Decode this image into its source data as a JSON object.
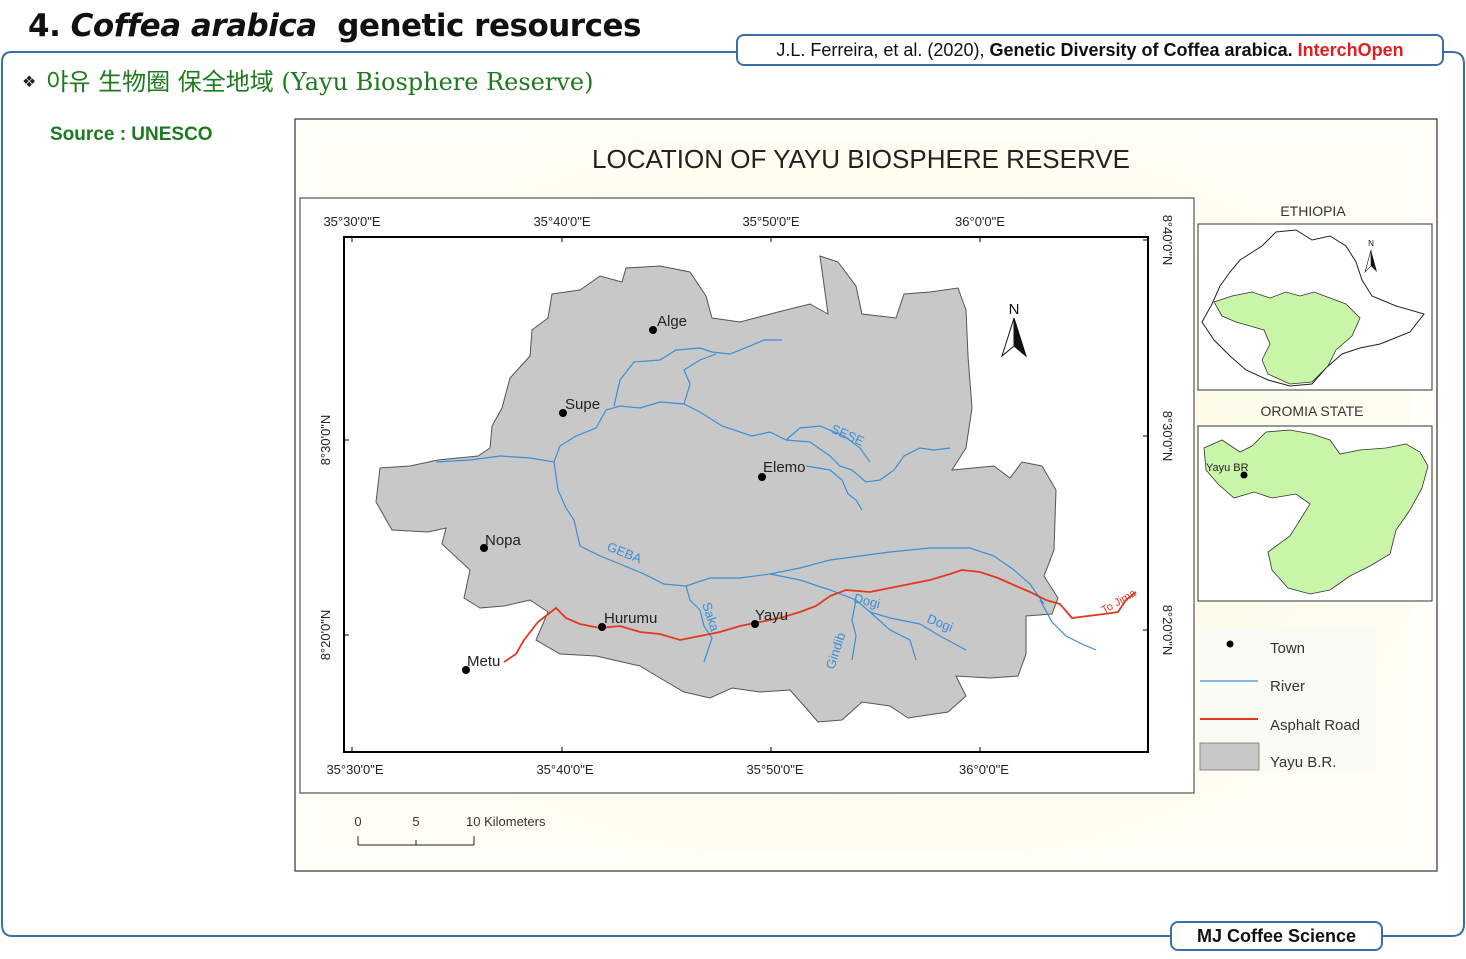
{
  "slide": {
    "title_prefix": "4.",
    "title_italic": "Coffea arabica",
    "title_rest": "genetic resources",
    "citation_authors": "J.L. Ferreira,  et al. (2020),",
    "citation_title": "Genetic Diversity of Coffea arabica.",
    "citation_publisher": "InterchOpen",
    "subtitle": "야유 生物圈 保全地域 (Yayu Biosphere Reserve)",
    "source": "Source : UNESCO",
    "footer": "MJ Coffee Science",
    "accent_color": "#3a6ea8",
    "green_color": "#1e7a1e"
  },
  "map": {
    "title": "LOCATION OF YAYU BIOSPHERE RESERVE",
    "lon_labels": [
      "35°30'0\"E",
      "35°40'0\"E",
      "35°50'0\"E",
      "36°0'0\"E"
    ],
    "lat_labels": [
      "8°40'0\"N",
      "8°30'0\"N",
      "8°20'0\"N"
    ],
    "north_label": "N",
    "towns": [
      "Alge",
      "Supe",
      "Elemo",
      "Nopa",
      "Hurumu",
      "Yayu",
      "Metu"
    ],
    "rivers": [
      "SESE",
      "GEBA",
      "Saka",
      "Dogi",
      "Dogi",
      "Gindib"
    ],
    "road_label": "To Jima",
    "inset_ethiopia": "ETHIOPIA",
    "inset_oromia": "OROMIA STATE",
    "inset_yayu_label": "Yayu BR",
    "legend": {
      "town": "Town",
      "river": "River",
      "road": "Asphalt Road",
      "reserve": "Yayu B.R."
    },
    "scale": {
      "ticks": [
        "0",
        "5",
        "10 Kilometers"
      ]
    },
    "colors": {
      "reserve_fill": "#c8c8c8",
      "river": "#3a8fd8",
      "road": "#e03a1e",
      "inset_fill": "#c8f5a8",
      "background": "#fdfbe8"
    }
  }
}
